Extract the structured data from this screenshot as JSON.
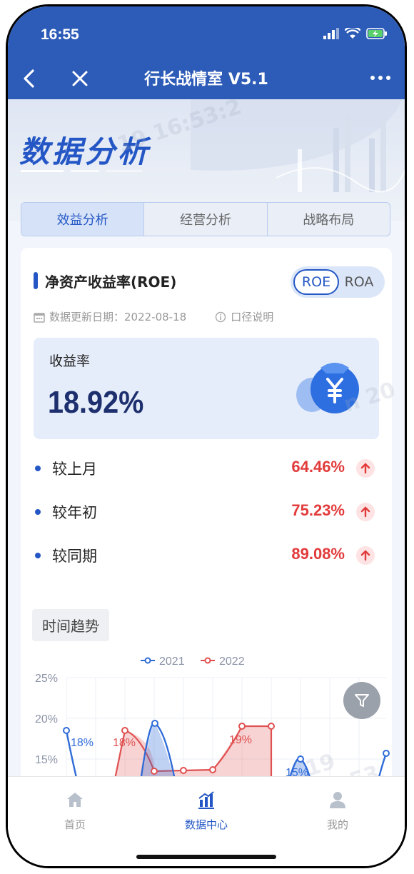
{
  "status_bar": {
    "time": "16:55"
  },
  "nav": {
    "title": "行长战情室 V5.1"
  },
  "banner": {
    "title": "数据分析"
  },
  "tabs": [
    {
      "label": "效益分析",
      "active": true
    },
    {
      "label": "经营分析",
      "active": false
    },
    {
      "label": "战略布局",
      "active": false
    }
  ],
  "card": {
    "title": "净资产收益率(ROE)",
    "toggle": {
      "option1": "ROE",
      "option2": "ROA",
      "selected": "ROE"
    },
    "update_label": "数据更新日期：2022-08-18",
    "caliber_label": "口径说明",
    "yield_label": "收益率",
    "yield_value": "18.92%",
    "comparisons": [
      {
        "label": "较上月",
        "value": "64.46%"
      },
      {
        "label": "较年初",
        "value": "75.23%"
      },
      {
        "label": "较同期",
        "value": "89.08%"
      }
    ],
    "trend_label": "时间趋势"
  },
  "chart_data": {
    "type": "area",
    "legend": [
      "2021",
      "2022"
    ],
    "y_ticks": [
      "25%",
      "20%",
      "15%"
    ],
    "ylim": [
      12,
      25
    ],
    "series": [
      {
        "name": "2021",
        "color": "#2f6bd8",
        "visible_labels": [
          "18%",
          "15%"
        ]
      },
      {
        "name": "2022",
        "color": "#e05050",
        "visible_labels": [
          "18%",
          "19%"
        ]
      }
    ],
    "grid": true,
    "legend_position": "top"
  },
  "bottom_nav": [
    {
      "label": "首页",
      "icon": "home-icon",
      "active": false
    },
    {
      "label": "数据中心",
      "icon": "bar-chart-icon",
      "active": true
    },
    {
      "label": "我的",
      "icon": "user-icon",
      "active": false
    }
  ],
  "colors": {
    "primary": "#2457c5",
    "nav_bg": "#2c5bb8",
    "up": "#e23b3b"
  }
}
